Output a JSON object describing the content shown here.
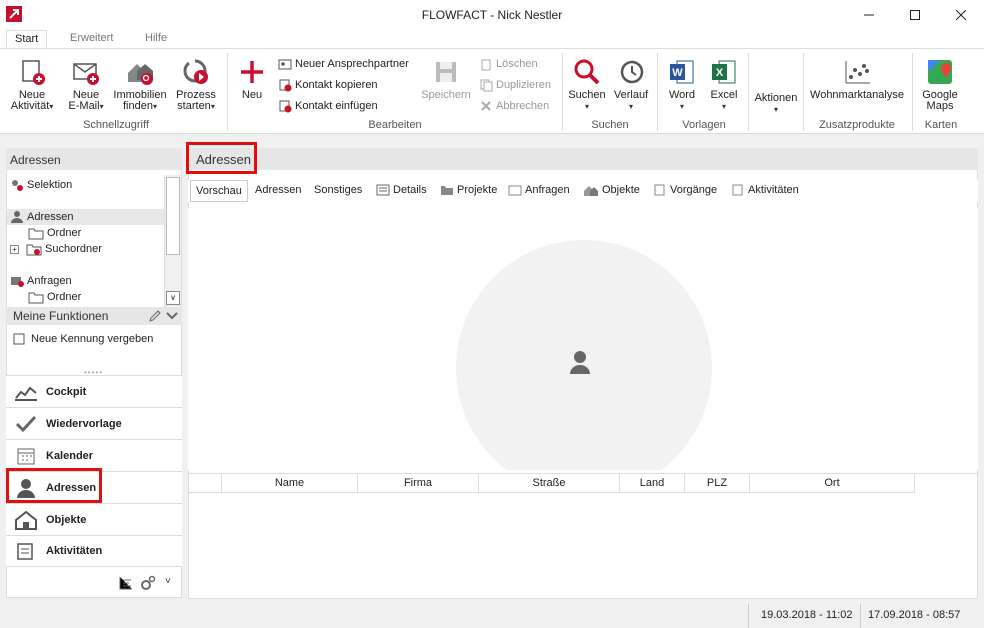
{
  "window": {
    "title": "FLOWFACT - Nick Nestler"
  },
  "tabs": [
    "Start",
    "Erweitert",
    "Hilfe"
  ],
  "ribbon": {
    "schnell": {
      "neue_aktivitaet_1": "Neue",
      "neue_aktivitaet_2": "Aktivität",
      "neue_email_1": "Neue",
      "neue_email_2": "E-Mail",
      "immobilien_1": "Immobilien",
      "immobilien_2": "finden",
      "prozess_1": "Prozess",
      "prozess_2": "starten",
      "group": "Schnellzugriff"
    },
    "bearbeiten": {
      "neu": "Neu",
      "neuer_ansprechpartner": "Neuer Ansprechpartner",
      "kontakt_kopieren": "Kontakt kopieren",
      "kontakt_einfuegen": "Kontakt einfügen",
      "speichern": "Speichern",
      "loeschen": "Löschen",
      "duplizieren": "Duplizieren",
      "abbrechen": "Abbrechen",
      "group": "Bearbeiten"
    },
    "suchen": {
      "suchen": "Suchen",
      "verlauf": "Verlauf",
      "group": "Suchen"
    },
    "vorlagen": {
      "word": "Word",
      "excel": "Excel",
      "group": "Vorlagen"
    },
    "aktionen": {
      "label": "Aktionen"
    },
    "zusatz": {
      "wohnmarkt": "Wohnmarktanalyse",
      "group": "Zusatzprodukte"
    },
    "karten": {
      "google_1": "Google",
      "google_2": "Maps",
      "group": "Karten"
    }
  },
  "left": {
    "header": "Adressen",
    "tree": {
      "selektion": "Selektion",
      "adressen": "Adressen",
      "ordner1": "Ordner",
      "suchordner": "Suchordner",
      "anfragen": "Anfragen",
      "ordner2": "Ordner"
    },
    "meine_funktionen": "Meine Funktionen",
    "neue_kennung": "Neue Kennung vergeben",
    "nav": [
      "Cockpit",
      "Wiedervorlage",
      "Kalender",
      "Adressen",
      "Objekte",
      "Aktivitäten"
    ]
  },
  "main": {
    "header": "Adressen",
    "subtabs": [
      "Vorschau",
      "Adressen",
      "Sonstiges",
      "Details",
      "Projekte",
      "Anfragen",
      "Objekte",
      "Vorgänge",
      "Aktivitäten"
    ],
    "columns": [
      "Name",
      "Firma",
      "Straße",
      "Land",
      "PLZ",
      "Ort"
    ]
  },
  "status": {
    "date1": "19.03.2018 - 11:02",
    "date2": "17.09.2018 - 08:57"
  },
  "colors": {
    "accent_red": "#e01010",
    "header_gray": "#e6e6e6"
  }
}
